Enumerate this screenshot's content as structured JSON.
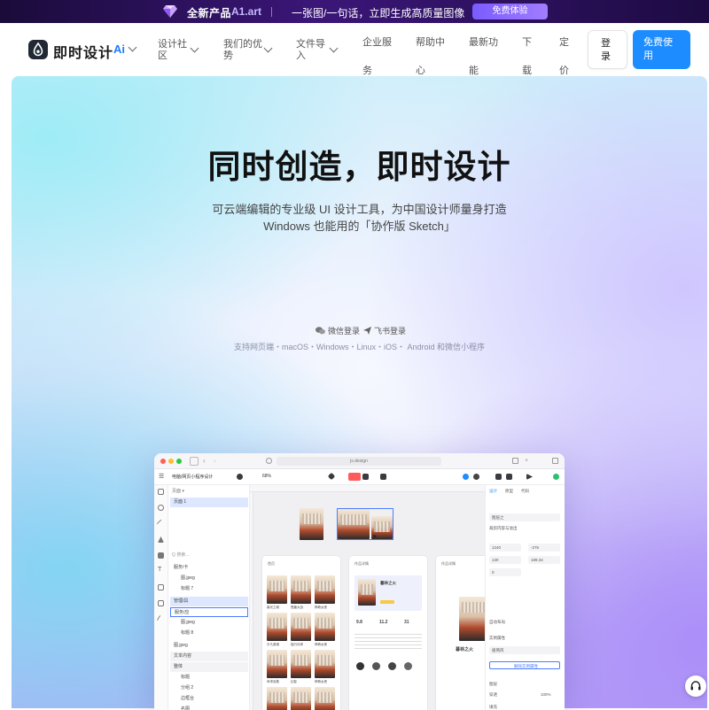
{
  "promo": {
    "title": "全新产品",
    "brand": "A1.art",
    "slogan": "一张图/一句话，立即生成高质量图像",
    "cta": "免费体验"
  },
  "nav": {
    "logo": "即时设计",
    "ai": "Ai",
    "items": [
      {
        "line1": "设计社",
        "line2": "区"
      },
      {
        "line1": "我们的优",
        "line2": "势"
      },
      {
        "line1": "文件导",
        "line2": "入"
      }
    ],
    "flat_items": [
      {
        "line1": "企业服",
        "line2": "务"
      },
      {
        "line1": "帮助中",
        "line2": "心"
      },
      {
        "line1": "最新功",
        "line2": "能"
      },
      {
        "line1": "下",
        "line2": "载"
      },
      {
        "line1": "定",
        "line2": "价"
      }
    ],
    "login": {
      "line1": "登",
      "line2": "录"
    },
    "free": {
      "line1": "免费使",
      "line2": "用"
    }
  },
  "hero": {
    "title": "同时创造，即时设计",
    "subtitle_1": "可云端编辑的专业级 UI 设计工具，为中国设计师量身打造",
    "subtitle_2": "Windows 也能用的「协作版 Sketch」",
    "wechat_login": "微信登录",
    "feishu_login": "飞书登录",
    "platforms": "支持网页端・macOS・Windows・Linux・iOS・ Android 和微信小程序"
  },
  "app": {
    "url": "js.design",
    "project": "电脑/网页小程序设计",
    "zoom": "68%",
    "page": "页面 1",
    "search": "Q 搜索...",
    "layers": [
      "服务/卡",
      "图.jpeg",
      "标题 7",
      "管理/具",
      "服务/应",
      "图.jpeg",
      "标题 8",
      "图.jpeg",
      "文本内容",
      "整体",
      "标题",
      "分组 2",
      "边框台",
      "名图"
    ],
    "frame_labels": [
      "首页",
      "作品详情",
      "作品详情"
    ],
    "props": {
      "tabs": [
        "设计",
        "原型",
        "代码"
      ],
      "component": "图层之",
      "clip": "裁剪内容与溢出",
      "x": "1240",
      "y": "-276",
      "w": "130",
      "h": "189.34",
      "r": "0",
      "opacity": "100%",
      "auto_layout": "自动布局",
      "variant": "实例属性",
      "style": "极简风",
      "detach": "解除实例属性",
      "layer_section": "图层",
      "mode": "穿透",
      "fill": "填充"
    },
    "cards": [
      [
        "暮光之城",
        "怪兽大战",
        "神奇女侠"
      ],
      [
        "平凡英雄",
        "独行月球",
        "神奇女侠"
      ],
      [
        "肖申克救",
        "幻影",
        "神奇女侠"
      ],
      [
        "寄生者",
        "盛夏",
        "神奇女侠"
      ]
    ],
    "detail": {
      "title": "暮林之火",
      "rating_1": "9.8",
      "rating_2": "11.2",
      "rating_3": "31"
    }
  }
}
